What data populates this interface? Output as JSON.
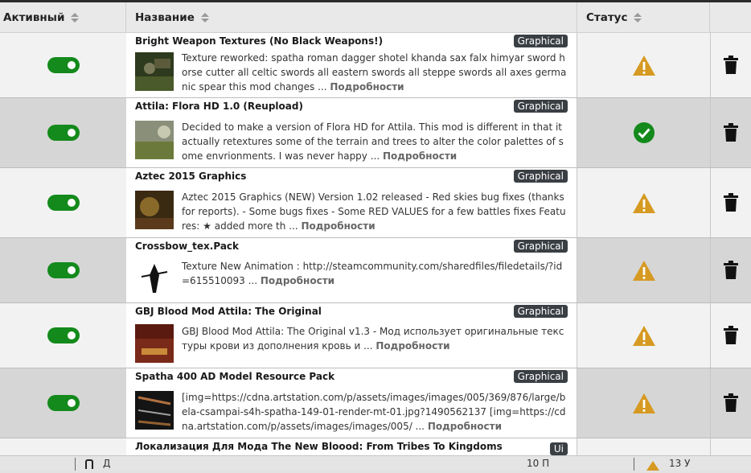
{
  "table": {
    "columns": {
      "active": "Активный",
      "name": "Название",
      "status": "Статус"
    },
    "more_label": "Подробности",
    "rows": [
      {
        "title": "Bright Weapon Textures (No Black Weapons!)",
        "tag": "Graphical",
        "active": true,
        "status": "warning",
        "description": "Texture reworked:  spatha roman dagger shotel khanda sax falx himyar sword horse cutter all celtic swords all eastern swords all steppe swords all axes germanic spear  this mod changes ..."
      },
      {
        "title": "Attila: Flora HD 1.0 (Reupload)",
        "tag": "Graphical",
        "active": true,
        "status": "ok",
        "description": "Decided to make a version of Flora HD for Attila. This mod is different in that it actually retextures some of the terrain and trees to alter the color palettes of some envrionments. I was never happy ..."
      },
      {
        "title": "Aztec 2015 Graphics",
        "tag": "Graphical",
        "active": true,
        "status": "warning",
        "description": "Aztec 2015 Graphics (NEW) Version 1.02 released  - Red skies bug fixes (thanks for reports). - Some bugs fixes - Some RED VALUES for a few battles fixes   Features: ★ added more th ..."
      },
      {
        "title": "Crossbow_tex.Pack",
        "tag": "Graphical",
        "active": true,
        "status": "warning",
        "description": "Texture  New Animation :  http://steamcommunity.com/sharedfiles/filedetails/?id=615510093 ..."
      },
      {
        "title": "GBJ Blood Mod Attila: The Original",
        "tag": "Graphical",
        "active": true,
        "status": "warning",
        "description": "GBJ Blood Mod Attila: The Original v1.3   - Мод использует оригинальные текстуры крови из дополнения кровь и ..."
      },
      {
        "title": "Spatha 400 AD Model Resource Pack",
        "tag": "Graphical",
        "active": true,
        "status": "warning",
        "description": "[img=https://cdna.artstation.com/p/assets/images/images/005/369/876/large/bela-csampai-s4h-spatha-149-01-render-mt-01.jpg?1490562137 [img=https://cdna.artstation.com/p/assets/images/images/005/ ..."
      },
      {
        "title": "Локализация Для Мода The New Bloood: From Tribes To Kingdoms",
        "tag": "Ui",
        "active": true,
        "status": "",
        "description": ""
      }
    ]
  },
  "footer": {
    "left_text": "Д",
    "mid_text": "10 П",
    "right_text": "13 У"
  },
  "colors": {
    "toggle_on": "#138a1b",
    "warning": "#d69a22",
    "ok": "#138a1b",
    "tag_bg": "#3a3f44"
  },
  "icons": {
    "sort": "sort-icon",
    "warning": "warning-icon",
    "ok": "check-circle-icon",
    "delete": "trash-icon"
  }
}
